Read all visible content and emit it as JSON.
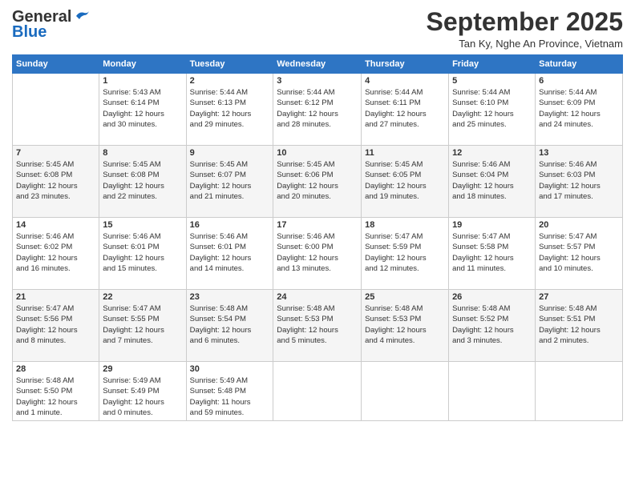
{
  "header": {
    "logo_general": "General",
    "logo_blue": "Blue",
    "month_title": "September 2025",
    "location": "Tan Ky, Nghe An Province, Vietnam"
  },
  "weekdays": [
    "Sunday",
    "Monday",
    "Tuesday",
    "Wednesday",
    "Thursday",
    "Friday",
    "Saturday"
  ],
  "weeks": [
    [
      {
        "day": "",
        "info": ""
      },
      {
        "day": "1",
        "info": "Sunrise: 5:43 AM\nSunset: 6:14 PM\nDaylight: 12 hours\nand 30 minutes."
      },
      {
        "day": "2",
        "info": "Sunrise: 5:44 AM\nSunset: 6:13 PM\nDaylight: 12 hours\nand 29 minutes."
      },
      {
        "day": "3",
        "info": "Sunrise: 5:44 AM\nSunset: 6:12 PM\nDaylight: 12 hours\nand 28 minutes."
      },
      {
        "day": "4",
        "info": "Sunrise: 5:44 AM\nSunset: 6:11 PM\nDaylight: 12 hours\nand 27 minutes."
      },
      {
        "day": "5",
        "info": "Sunrise: 5:44 AM\nSunset: 6:10 PM\nDaylight: 12 hours\nand 25 minutes."
      },
      {
        "day": "6",
        "info": "Sunrise: 5:44 AM\nSunset: 6:09 PM\nDaylight: 12 hours\nand 24 minutes."
      }
    ],
    [
      {
        "day": "7",
        "info": "Sunrise: 5:45 AM\nSunset: 6:08 PM\nDaylight: 12 hours\nand 23 minutes."
      },
      {
        "day": "8",
        "info": "Sunrise: 5:45 AM\nSunset: 6:08 PM\nDaylight: 12 hours\nand 22 minutes."
      },
      {
        "day": "9",
        "info": "Sunrise: 5:45 AM\nSunset: 6:07 PM\nDaylight: 12 hours\nand 21 minutes."
      },
      {
        "day": "10",
        "info": "Sunrise: 5:45 AM\nSunset: 6:06 PM\nDaylight: 12 hours\nand 20 minutes."
      },
      {
        "day": "11",
        "info": "Sunrise: 5:45 AM\nSunset: 6:05 PM\nDaylight: 12 hours\nand 19 minutes."
      },
      {
        "day": "12",
        "info": "Sunrise: 5:46 AM\nSunset: 6:04 PM\nDaylight: 12 hours\nand 18 minutes."
      },
      {
        "day": "13",
        "info": "Sunrise: 5:46 AM\nSunset: 6:03 PM\nDaylight: 12 hours\nand 17 minutes."
      }
    ],
    [
      {
        "day": "14",
        "info": "Sunrise: 5:46 AM\nSunset: 6:02 PM\nDaylight: 12 hours\nand 16 minutes."
      },
      {
        "day": "15",
        "info": "Sunrise: 5:46 AM\nSunset: 6:01 PM\nDaylight: 12 hours\nand 15 minutes."
      },
      {
        "day": "16",
        "info": "Sunrise: 5:46 AM\nSunset: 6:01 PM\nDaylight: 12 hours\nand 14 minutes."
      },
      {
        "day": "17",
        "info": "Sunrise: 5:46 AM\nSunset: 6:00 PM\nDaylight: 12 hours\nand 13 minutes."
      },
      {
        "day": "18",
        "info": "Sunrise: 5:47 AM\nSunset: 5:59 PM\nDaylight: 12 hours\nand 12 minutes."
      },
      {
        "day": "19",
        "info": "Sunrise: 5:47 AM\nSunset: 5:58 PM\nDaylight: 12 hours\nand 11 minutes."
      },
      {
        "day": "20",
        "info": "Sunrise: 5:47 AM\nSunset: 5:57 PM\nDaylight: 12 hours\nand 10 minutes."
      }
    ],
    [
      {
        "day": "21",
        "info": "Sunrise: 5:47 AM\nSunset: 5:56 PM\nDaylight: 12 hours\nand 8 minutes."
      },
      {
        "day": "22",
        "info": "Sunrise: 5:47 AM\nSunset: 5:55 PM\nDaylight: 12 hours\nand 7 minutes."
      },
      {
        "day": "23",
        "info": "Sunrise: 5:48 AM\nSunset: 5:54 PM\nDaylight: 12 hours\nand 6 minutes."
      },
      {
        "day": "24",
        "info": "Sunrise: 5:48 AM\nSunset: 5:53 PM\nDaylight: 12 hours\nand 5 minutes."
      },
      {
        "day": "25",
        "info": "Sunrise: 5:48 AM\nSunset: 5:53 PM\nDaylight: 12 hours\nand 4 minutes."
      },
      {
        "day": "26",
        "info": "Sunrise: 5:48 AM\nSunset: 5:52 PM\nDaylight: 12 hours\nand 3 minutes."
      },
      {
        "day": "27",
        "info": "Sunrise: 5:48 AM\nSunset: 5:51 PM\nDaylight: 12 hours\nand 2 minutes."
      }
    ],
    [
      {
        "day": "28",
        "info": "Sunrise: 5:48 AM\nSunset: 5:50 PM\nDaylight: 12 hours\nand 1 minute."
      },
      {
        "day": "29",
        "info": "Sunrise: 5:49 AM\nSunset: 5:49 PM\nDaylight: 12 hours\nand 0 minutes."
      },
      {
        "day": "30",
        "info": "Sunrise: 5:49 AM\nSunset: 5:48 PM\nDaylight: 11 hours\nand 59 minutes."
      },
      {
        "day": "",
        "info": ""
      },
      {
        "day": "",
        "info": ""
      },
      {
        "day": "",
        "info": ""
      },
      {
        "day": "",
        "info": ""
      }
    ]
  ]
}
